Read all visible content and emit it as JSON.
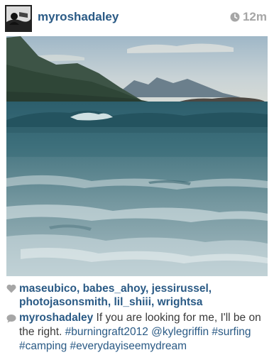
{
  "header": {
    "username": "myroshadaley",
    "time": "12m"
  },
  "likes": {
    "names": "maseubico, babes_ahoy, jessirussel, photojasonsmith, lil_shiii, wrightsa"
  },
  "caption": {
    "author": "myroshadaley",
    "text_part1": " If you are looking for me, I'll be on the right. ",
    "hashtag1": "#burningraft2012",
    "mention1": "@kylegriffin",
    "hashtag2": "#surfing",
    "hashtag3": "#camping",
    "hashtag4": "#everydayiseemydream"
  },
  "colors": {
    "link": "#2a5a85",
    "muted": "#a6a6a6"
  }
}
